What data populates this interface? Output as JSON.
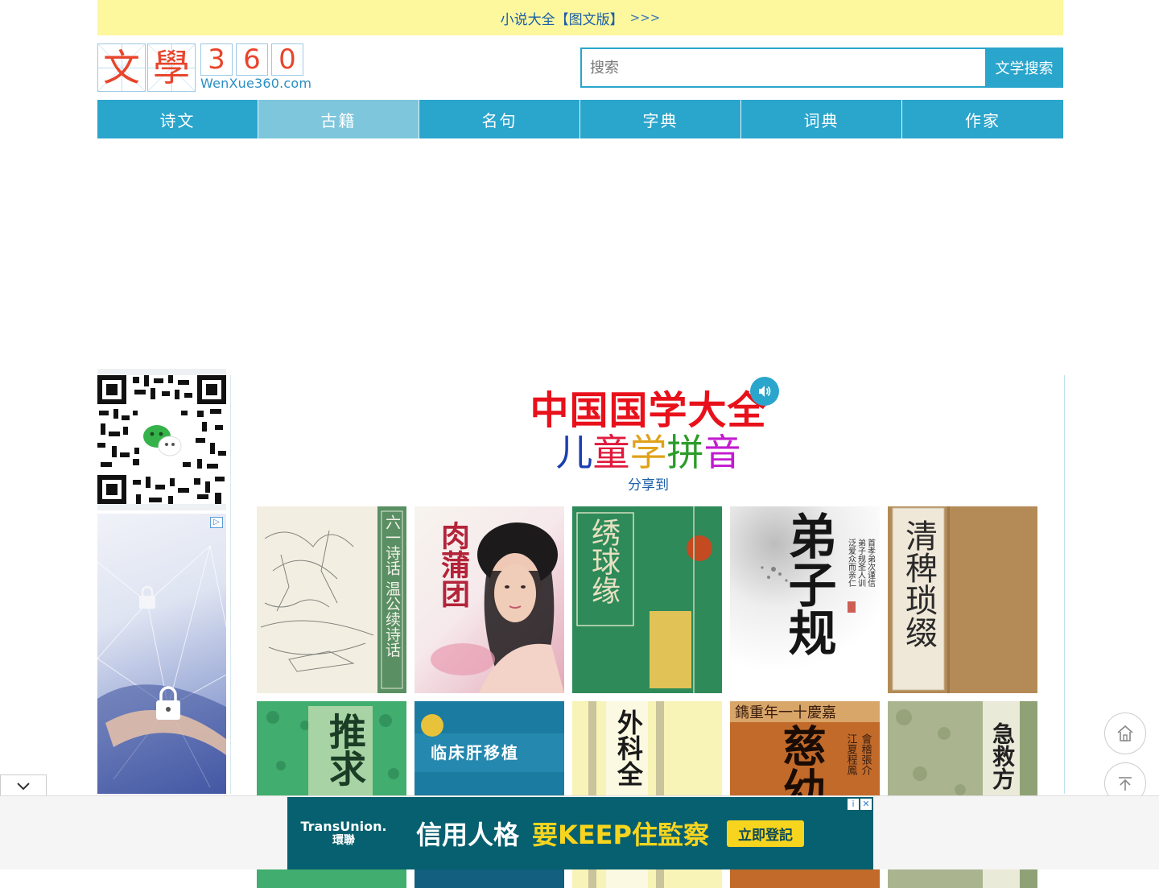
{
  "topbar": {
    "link": "小说大全【图文版】",
    "arrows": ">>>"
  },
  "logo": {
    "char1": "文",
    "char2": "學",
    "d1": "3",
    "d2": "6",
    "d3": "0",
    "domain": "WenXue360.com"
  },
  "search": {
    "placeholder": "搜索",
    "button": "文学搜索"
  },
  "nav": [
    "诗文",
    "古籍",
    "名句",
    "字典",
    "词典",
    "作家"
  ],
  "nav_active": "古籍",
  "main": {
    "title": "中国国学大全",
    "subtitle_chars": [
      "儿",
      "童",
      "学",
      "拼",
      "音"
    ],
    "subtitle_colors": [
      "#1a3fb0",
      "#e01a3c",
      "#e0a21a",
      "#2c9c2a",
      "#c21ad0"
    ],
    "share": "分享到"
  },
  "books": [
    {
      "name": "六一诗话 温公续诗话"
    },
    {
      "name": "肉蒲团"
    },
    {
      "name": "绣球缘"
    },
    {
      "name": "弟子规"
    },
    {
      "name": "清稗琐缀"
    },
    {
      "name": "推求"
    },
    {
      "name": "临床肝移植"
    },
    {
      "name": "外科全"
    },
    {
      "name": "慈幼"
    },
    {
      "name": "急救方"
    }
  ],
  "bottom_ad": {
    "brand_en": "TransUnion.",
    "brand_zh": "環聯",
    "slogan": "信用人格",
    "slogan2": "要KEEP住監察",
    "cta": "立即登記"
  },
  "icons": {
    "home": "home-icon",
    "top": "back-to-top-icon",
    "speaker": "speaker-icon",
    "chevron": "chevron-down-icon"
  }
}
